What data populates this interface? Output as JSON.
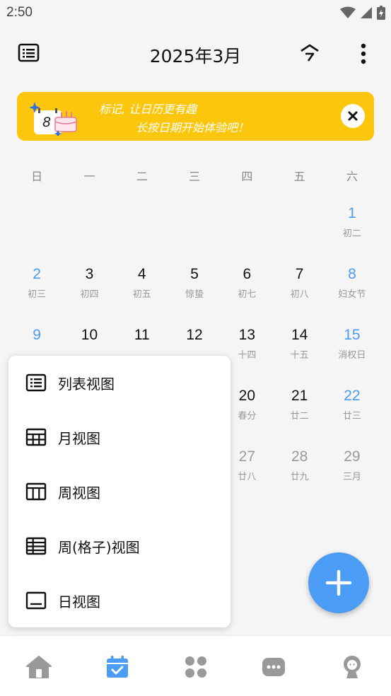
{
  "status_bar": {
    "time": "2:50"
  },
  "header": {
    "title": "2025年3月",
    "today_label": "今"
  },
  "banner": {
    "line1": "标记, 让日历更有趣",
    "line2": "长按日期开始体验吧！",
    "art_number": "8"
  },
  "weekdays": [
    "日",
    "一",
    "二",
    "三",
    "四",
    "五",
    "六"
  ],
  "calendar": {
    "days": [
      {
        "num": "",
        "lunar": ""
      },
      {
        "num": "",
        "lunar": ""
      },
      {
        "num": "",
        "lunar": ""
      },
      {
        "num": "",
        "lunar": ""
      },
      {
        "num": "",
        "lunar": ""
      },
      {
        "num": "",
        "lunar": ""
      },
      {
        "num": "1",
        "lunar": "初二"
      },
      {
        "num": "2",
        "lunar": "初三"
      },
      {
        "num": "3",
        "lunar": "初四"
      },
      {
        "num": "4",
        "lunar": "初五"
      },
      {
        "num": "5",
        "lunar": "惊蛰"
      },
      {
        "num": "6",
        "lunar": "初七"
      },
      {
        "num": "7",
        "lunar": "初八"
      },
      {
        "num": "8",
        "lunar": "妇女节"
      },
      {
        "num": "9",
        "lunar": ""
      },
      {
        "num": "10",
        "lunar": ""
      },
      {
        "num": "11",
        "lunar": ""
      },
      {
        "num": "12",
        "lunar": ""
      },
      {
        "num": "13",
        "lunar": "十四"
      },
      {
        "num": "14",
        "lunar": "十五"
      },
      {
        "num": "15",
        "lunar": "消权日"
      },
      {
        "num": "",
        "lunar": ""
      },
      {
        "num": "",
        "lunar": ""
      },
      {
        "num": "",
        "lunar": ""
      },
      {
        "num": "",
        "lunar": ""
      },
      {
        "num": "20",
        "lunar": "春分"
      },
      {
        "num": "21",
        "lunar": "廿二"
      },
      {
        "num": "22",
        "lunar": "廿三"
      },
      {
        "num": "",
        "lunar": ""
      },
      {
        "num": "",
        "lunar": ""
      },
      {
        "num": "",
        "lunar": ""
      },
      {
        "num": "",
        "lunar": ""
      },
      {
        "num": "27",
        "lunar": "廿八"
      },
      {
        "num": "28",
        "lunar": "廿九"
      },
      {
        "num": "29",
        "lunar": "三月"
      }
    ]
  },
  "view_menu": {
    "items": [
      "列表视图",
      "月视图",
      "周视图",
      "周(格子)视图",
      "日视图"
    ]
  },
  "colors": {
    "accent": "#4a9cf5",
    "banner": "#fcc60c",
    "nav_icon": "#999999"
  },
  "icons": {
    "nav": [
      "home-icon",
      "calendar-icon",
      "apps-icon",
      "chat-icon",
      "profile-icon"
    ]
  }
}
